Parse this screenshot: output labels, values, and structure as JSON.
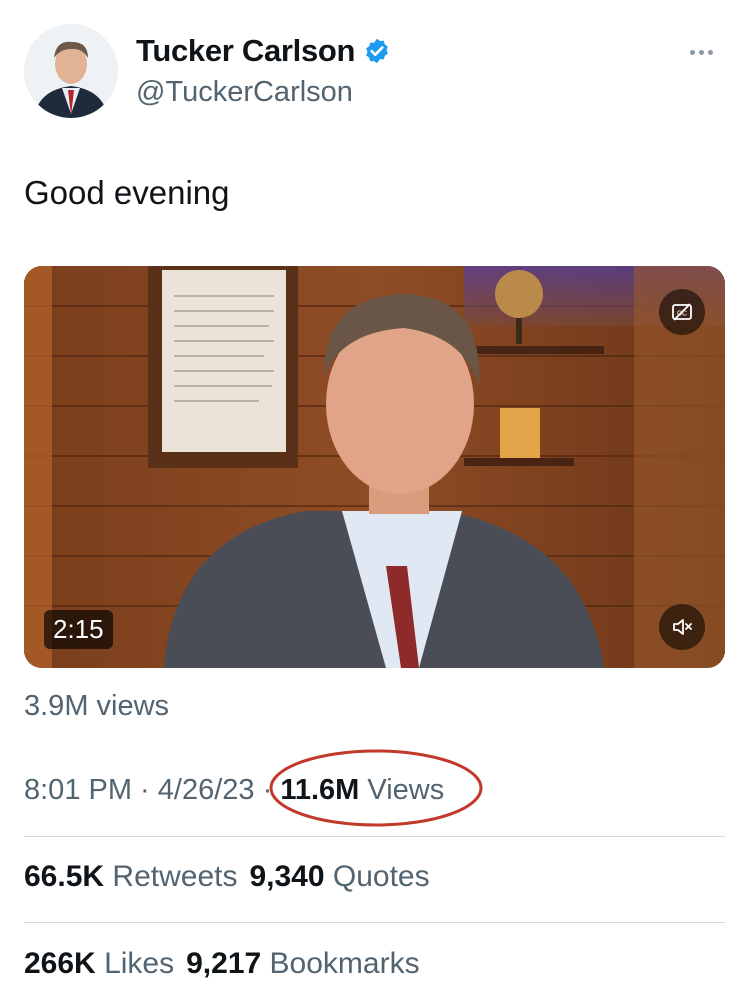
{
  "author": {
    "display_name": "Tucker Carlson",
    "handle": "@TuckerCarlson",
    "verified_color": "#1d9bf0"
  },
  "tweet": {
    "text": "Good evening"
  },
  "video": {
    "duration": "2:15",
    "views_label": "3.9M views"
  },
  "meta": {
    "time": "8:01 PM",
    "separator": " · ",
    "date": "4/26/23",
    "separator2": " · ",
    "views_count": "11.6M",
    "views_word": "Views"
  },
  "stats": {
    "retweets_count": "66.5K",
    "retweets_label": "Retweets",
    "quotes_count": "9,340",
    "quotes_label": "Quotes",
    "likes_count": "266K",
    "likes_label": "Likes",
    "bookmarks_count": "9,217",
    "bookmarks_label": "Bookmarks"
  },
  "colors": {
    "annotation_circle": "#c0392b",
    "secondary_text": "#536471"
  }
}
